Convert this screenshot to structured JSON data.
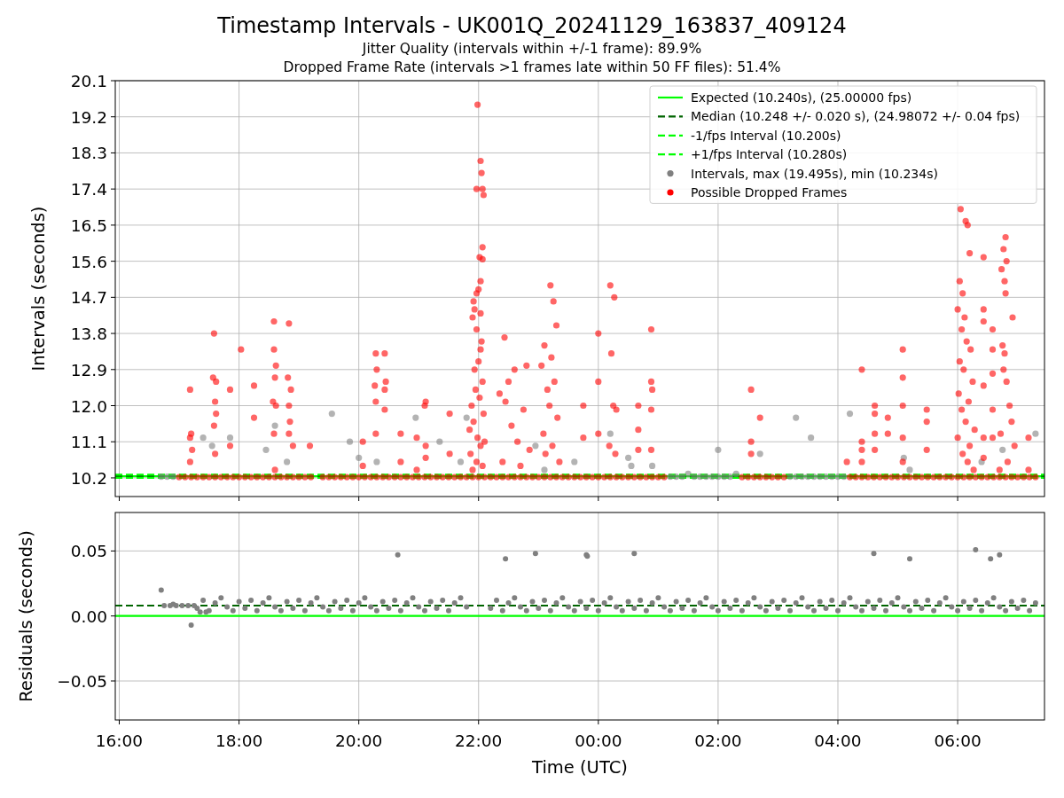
{
  "figure": {
    "title": "Timestamp Intervals - UK001Q_20241129_163837_409124",
    "subtitles": [
      "Jitter Quality (intervals within +/-1 frame): 89.9%",
      "Dropped Frame Rate (intervals >1 frames late within 50 FF files): 51.4%"
    ]
  },
  "plots": [
    {
      "chart_data": {
        "type": "scatter",
        "ylabel": "Intervals (seconds)",
        "legend": true,
        "grid": true,
        "xlim": [
          "2024-11-29T15:56",
          "2024-11-30T07:27"
        ],
        "ylim": [
          9.735,
          20.1
        ],
        "yticks": [
          {
            "value": 10.2,
            "label": "10.2"
          },
          {
            "value": 11.1,
            "label": "11.1"
          },
          {
            "value": 12.0,
            "label": "12.0"
          },
          {
            "value": 12.9,
            "label": "12.9"
          },
          {
            "value": 13.8,
            "label": "13.8"
          },
          {
            "value": 14.7,
            "label": "14.7"
          },
          {
            "value": 15.6,
            "label": "15.6"
          },
          {
            "value": 16.5,
            "label": "16.5"
          },
          {
            "value": 17.4,
            "label": "17.4"
          },
          {
            "value": 18.3,
            "label": "18.3"
          },
          {
            "value": 19.2,
            "label": "19.2"
          },
          {
            "value": 20.1,
            "label": "20.1"
          }
        ],
        "ref_lines": [
          {
            "axis": "y",
            "value": 10.24,
            "label": "Expected (10.240s), (25.00000 fps)",
            "color": "#00ff00"
          },
          {
            "axis": "y",
            "value": 10.248,
            "label": "Median (10.248 +/- 0.020 s), (24.98072 +/- 0.04 fps)",
            "color": "#006400"
          },
          {
            "axis": "y",
            "value": 10.2,
            "label": "-1/fps Interval (10.200s)",
            "color": "#00ff00"
          },
          {
            "axis": "y",
            "value": 10.28,
            "label": "+1/fps Interval (10.280s)",
            "color": "#00ff00"
          }
        ],
        "series": [
          {
            "name": "Intervals, max (19.495s), min (10.234s)",
            "color": "#808080",
            "x": [
              "2024-11-29T16:42",
              "2024-11-29T16:48",
              "2024-11-29T16:54",
              "2024-11-30T01:12",
              "2024-11-30T01:18",
              "2024-11-30T01:24",
              "2024-11-30T01:30",
              "2024-11-30T01:36",
              "2024-11-30T01:42",
              "2024-11-30T01:48",
              "2024-11-30T01:54",
              "2024-11-30T02:00",
              "2024-11-30T02:06",
              "2024-11-30T02:12",
              "2024-11-30T02:18",
              "2024-11-30T03:12",
              "2024-11-30T03:18",
              "2024-11-30T03:24",
              "2024-11-30T03:30",
              "2024-11-30T03:36",
              "2024-11-30T03:42",
              "2024-11-30T03:48",
              "2024-11-30T03:54",
              "2024-11-30T04:00",
              "2024-11-30T04:06",
              "2024-11-29T17:24",
              "2024-11-29T17:33",
              "2024-11-29T17:51",
              "2024-11-29T18:36",
              "2024-11-29T18:27",
              "2024-11-29T18:48",
              "2024-11-29T19:33",
              "2024-11-29T19:51",
              "2024-11-29T20:00",
              "2024-11-29T20:18",
              "2024-11-29T20:57",
              "2024-11-29T21:21",
              "2024-11-29T21:42",
              "2024-11-29T21:48",
              "2024-11-29T22:57",
              "2024-11-29T23:36",
              "2024-11-29T23:06",
              "2024-11-30T00:12",
              "2024-11-30T00:30",
              "2024-11-30T00:33",
              "2024-11-30T00:54",
              "2024-11-30T02:00",
              "2024-11-30T02:42",
              "2024-11-30T03:18",
              "2024-11-30T03:33",
              "2024-11-30T04:12",
              "2024-11-30T05:06",
              "2024-11-30T05:12",
              "2024-11-30T06:45",
              "2024-11-30T07:18",
              "2024-11-30T06:24"
            ],
            "values": [
              10.23,
              10.23,
              10.23,
              10.23,
              10.23,
              10.23,
              10.3,
              10.23,
              10.23,
              10.23,
              10.23,
              10.23,
              10.23,
              10.23,
              10.3,
              10.23,
              10.23,
              10.23,
              10.23,
              10.23,
              10.23,
              10.23,
              10.23,
              10.23,
              10.23,
              11.2,
              11.0,
              11.2,
              11.5,
              10.9,
              10.6,
              11.8,
              11.1,
              10.7,
              10.6,
              11.7,
              11.1,
              10.6,
              11.7,
              11.0,
              10.6,
              10.4,
              11.3,
              10.7,
              10.5,
              10.5,
              10.9,
              10.8,
              11.7,
              11.2,
              11.8,
              10.7,
              10.4,
              10.9,
              11.3,
              10.6
            ]
          },
          {
            "name": "Possible Dropped Frames",
            "color": "#ff0000",
            "x": [
              "2024-11-29T17:00",
              "2024-11-29T17:06",
              "2024-11-29T17:12",
              "2024-11-29T17:18",
              "2024-11-29T17:24",
              "2024-11-29T17:30",
              "2024-11-29T17:36",
              "2024-11-29T17:42",
              "2024-11-29T17:48",
              "2024-11-29T17:54",
              "2024-11-29T18:00",
              "2024-11-29T18:06",
              "2024-11-29T18:12",
              "2024-11-29T18:18",
              "2024-11-29T18:24",
              "2024-11-29T18:30",
              "2024-11-29T18:36",
              "2024-11-29T18:42",
              "2024-11-29T18:48",
              "2024-11-29T18:54",
              "2024-11-29T19:00",
              "2024-11-29T19:06",
              "2024-11-29T19:12",
              "2024-11-29T19:24",
              "2024-11-29T19:30",
              "2024-11-29T19:36",
              "2024-11-29T19:42",
              "2024-11-29T19:48",
              "2024-11-29T19:54",
              "2024-11-29T20:00",
              "2024-11-29T20:06",
              "2024-11-29T20:12",
              "2024-11-29T20:18",
              "2024-11-29T20:24",
              "2024-11-29T20:30",
              "2024-11-29T20:36",
              "2024-11-29T20:42",
              "2024-11-29T20:48",
              "2024-11-29T20:54",
              "2024-11-29T21:00",
              "2024-11-29T21:06",
              "2024-11-29T21:12",
              "2024-11-29T21:18",
              "2024-11-29T21:24",
              "2024-11-29T21:30",
              "2024-11-29T21:36",
              "2024-11-29T21:42",
              "2024-11-29T21:48",
              "2024-11-29T21:54",
              "2024-11-29T22:00",
              "2024-11-29T22:06",
              "2024-11-29T22:12",
              "2024-11-29T22:18",
              "2024-11-29T22:24",
              "2024-11-29T22:30",
              "2024-11-29T22:36",
              "2024-11-29T22:42",
              "2024-11-29T22:48",
              "2024-11-29T22:54",
              "2024-11-29T23:00",
              "2024-11-29T23:06",
              "2024-11-29T23:12",
              "2024-11-29T23:18",
              "2024-11-29T23:24",
              "2024-11-29T23:30",
              "2024-11-29T23:36",
              "2024-11-29T23:42",
              "2024-11-29T23:48",
              "2024-11-29T23:54",
              "2024-11-30T00:00",
              "2024-11-30T00:06",
              "2024-11-30T00:12",
              "2024-11-30T00:18",
              "2024-11-30T00:24",
              "2024-11-30T00:30",
              "2024-11-30T00:36",
              "2024-11-30T00:42",
              "2024-11-30T00:48",
              "2024-11-30T00:54",
              "2024-11-30T01:00",
              "2024-11-30T01:06",
              "2024-11-30T02:24",
              "2024-11-30T02:30",
              "2024-11-30T02:36",
              "2024-11-30T02:42",
              "2024-11-30T02:48",
              "2024-11-30T02:54",
              "2024-11-30T03:00",
              "2024-11-30T03:06",
              "2024-11-30T04:12",
              "2024-11-30T04:18",
              "2024-11-30T04:24",
              "2024-11-30T04:30",
              "2024-11-30T04:36",
              "2024-11-30T04:42",
              "2024-11-30T04:48",
              "2024-11-30T04:54",
              "2024-11-30T05:00",
              "2024-11-30T05:06",
              "2024-11-30T05:12",
              "2024-11-30T05:18",
              "2024-11-30T05:24",
              "2024-11-30T05:30",
              "2024-11-30T05:36",
              "2024-11-30T05:42",
              "2024-11-30T05:48",
              "2024-11-30T05:54",
              "2024-11-30T06:00",
              "2024-11-30T06:06",
              "2024-11-30T06:12",
              "2024-11-30T06:18",
              "2024-11-30T06:24",
              "2024-11-30T06:30",
              "2024-11-30T06:36",
              "2024-11-30T06:42",
              "2024-11-30T06:48",
              "2024-11-30T06:54",
              "2024-11-30T07:00",
              "2024-11-30T07:06",
              "2024-11-30T07:12",
              "2024-11-30T07:18",
              "2024-11-29T17:11",
              "2024-11-29T17:12",
              "2024-11-29T17:11",
              "2024-11-29T17:13",
              "2024-11-29T17:11",
              "2024-11-29T17:35",
              "2024-11-29T17:34",
              "2024-11-29T17:37",
              "2024-11-29T17:36",
              "2024-11-29T17:37",
              "2024-11-29T17:35",
              "2024-11-29T17:36",
              "2024-11-29T17:51",
              "2024-11-29T17:51",
              "2024-11-29T18:02",
              "2024-11-29T18:15",
              "2024-11-29T18:15",
              "2024-11-29T18:35",
              "2024-11-29T18:35",
              "2024-11-29T18:37",
              "2024-11-29T18:36",
              "2024-11-29T18:34",
              "2024-11-29T18:37",
              "2024-11-29T18:35",
              "2024-11-29T18:36",
              "2024-11-29T18:50",
              "2024-11-29T18:49",
              "2024-11-29T18:52",
              "2024-11-29T18:50",
              "2024-11-29T18:51",
              "2024-11-29T18:50",
              "2024-11-29T18:54",
              "2024-11-29T19:11",
              "2024-11-29T20:04",
              "2024-11-29T20:04",
              "2024-11-29T20:17",
              "2024-11-29T20:18",
              "2024-11-29T20:16",
              "2024-11-29T20:17",
              "2024-11-29T20:17",
              "2024-11-29T20:26",
              "2024-11-29T20:27",
              "2024-11-29T20:26",
              "2024-11-29T20:26",
              "2024-11-29T20:42",
              "2024-11-29T20:42",
              "2024-11-29T20:58",
              "2024-11-29T20:58",
              "2024-11-29T21:07",
              "2024-11-29T21:06",
              "2024-11-29T21:07",
              "2024-11-29T21:07",
              "2024-11-29T21:31",
              "2024-11-29T21:31",
              "2024-11-29T21:59",
              "2024-11-29T22:02",
              "2024-11-29T22:03",
              "2024-11-29T21:58",
              "2024-11-29T22:04",
              "2024-11-29T22:05",
              "2024-11-29T22:04",
              "2024-11-29T22:01",
              "2024-11-29T22:04",
              "2024-11-29T22:02",
              "2024-11-29T22:00",
              "2024-11-29T21:58",
              "2024-11-29T21:55",
              "2024-11-29T21:56",
              "2024-11-29T22:02",
              "2024-11-29T21:54",
              "2024-11-29T21:58",
              "2024-11-29T22:03",
              "2024-11-29T22:02",
              "2024-11-29T22:00",
              "2024-11-29T21:56",
              "2024-11-29T22:04",
              "2024-11-29T21:57",
              "2024-11-29T22:01",
              "2024-11-29T21:53",
              "2024-11-29T22:05",
              "2024-11-29T21:55",
              "2024-11-29T21:51",
              "2024-11-29T21:59",
              "2024-11-29T22:06",
              "2024-11-29T22:02",
              "2024-11-29T21:52",
              "2024-11-29T21:58",
              "2024-11-29T22:04",
              "2024-11-29T21:54",
              "2024-11-29T22:26",
              "2024-11-29T22:48",
              "2024-11-29T22:36",
              "2024-11-29T22:30",
              "2024-11-29T22:21",
              "2024-11-29T22:27",
              "2024-11-29T22:45",
              "2024-11-29T22:33",
              "2024-11-29T22:39",
              "2024-11-29T22:51",
              "2024-11-29T22:24",
              "2024-11-29T22:42",
              "2024-11-29T23:12",
              "2024-11-29T23:15",
              "2024-11-29T23:18",
              "2024-11-29T23:06",
              "2024-11-29T23:13",
              "2024-11-29T23:03",
              "2024-11-29T23:16",
              "2024-11-29T23:09",
              "2024-11-29T23:11",
              "2024-11-29T23:19",
              "2024-11-29T23:05",
              "2024-11-29T23:14",
              "2024-11-29T23:07",
              "2024-11-29T23:21",
              "2024-11-29T23:45",
              "2024-11-29T23:45",
              "2024-11-30T00:00",
              "2024-11-30T00:00",
              "2024-11-30T00:00",
              "2024-11-30T00:12",
              "2024-11-30T00:16",
              "2024-11-30T00:13",
              "2024-11-30T00:15",
              "2024-11-30T00:18",
              "2024-11-30T00:11",
              "2024-11-30T00:17",
              "2024-11-30T00:40",
              "2024-11-30T00:40",
              "2024-11-30T00:40",
              "2024-11-30T00:53",
              "2024-11-30T00:53",
              "2024-11-30T00:54",
              "2024-11-30T00:53",
              "2024-11-30T00:53",
              "2024-11-30T02:33",
              "2024-11-30T02:33",
              "2024-11-30T02:33",
              "2024-11-30T02:42",
              "2024-11-30T04:09",
              "2024-11-30T04:24",
              "2024-11-30T04:24",
              "2024-11-30T04:24",
              "2024-11-30T04:24",
              "2024-11-30T04:37",
              "2024-11-30T04:37",
              "2024-11-30T04:37",
              "2024-11-30T04:37",
              "2024-11-30T04:50",
              "2024-11-30T04:50",
              "2024-11-30T05:05",
              "2024-11-30T05:05",
              "2024-11-30T05:05",
              "2024-11-30T05:05",
              "2024-11-30T05:05",
              "2024-11-30T05:29",
              "2024-11-30T05:29",
              "2024-11-30T05:29",
              "2024-11-30T06:03",
              "2024-11-30T06:08",
              "2024-11-30T06:10",
              "2024-11-30T06:12",
              "2024-11-30T06:02",
              "2024-11-30T06:05",
              "2024-11-30T06:00",
              "2024-11-30T06:07",
              "2024-11-30T06:04",
              "2024-11-30T06:09",
              "2024-11-30T06:13",
              "2024-11-30T06:02",
              "2024-11-30T06:06",
              "2024-11-30T06:15",
              "2024-11-30T06:01",
              "2024-11-30T06:11",
              "2024-11-30T06:04",
              "2024-11-30T06:08",
              "2024-11-30T06:17",
              "2024-11-30T06:00",
              "2024-11-30T06:12",
              "2024-11-30T06:05",
              "2024-11-30T06:10",
              "2024-11-30T06:16",
              "2024-11-30T06:26",
              "2024-11-30T06:26",
              "2024-11-30T06:26",
              "2024-11-30T06:26",
              "2024-11-30T06:26",
              "2024-11-30T06:26",
              "2024-11-30T06:35",
              "2024-11-30T06:35",
              "2024-11-30T06:35",
              "2024-11-30T06:35",
              "2024-11-30T06:35",
              "2024-11-30T06:48",
              "2024-11-30T06:46",
              "2024-11-30T06:49",
              "2024-11-30T06:44",
              "2024-11-30T06:47",
              "2024-11-30T06:48",
              "2024-11-30T06:55",
              "2024-11-30T06:45",
              "2024-11-30T06:47",
              "2024-11-30T06:46",
              "2024-11-30T06:49",
              "2024-11-30T06:52",
              "2024-11-30T06:54",
              "2024-11-30T06:43",
              "2024-11-30T06:57",
              "2024-11-30T06:50",
              "2024-11-30T06:42",
              "2024-11-30T07:11",
              "2024-11-30T07:11"
            ],
            "values": [
              10.22,
              10.22,
              10.22,
              10.22,
              10.22,
              10.22,
              10.22,
              10.22,
              10.22,
              10.22,
              10.22,
              10.22,
              10.22,
              10.22,
              10.22,
              10.22,
              10.22,
              10.22,
              10.22,
              10.22,
              10.22,
              10.22,
              10.22,
              10.22,
              10.22,
              10.22,
              10.22,
              10.22,
              10.22,
              10.22,
              10.22,
              10.22,
              10.22,
              10.22,
              10.22,
              10.22,
              10.22,
              10.22,
              10.22,
              10.22,
              10.22,
              10.22,
              10.22,
              10.22,
              10.22,
              10.22,
              10.22,
              10.22,
              10.22,
              10.22,
              10.22,
              10.22,
              10.22,
              10.22,
              10.22,
              10.22,
              10.22,
              10.22,
              10.22,
              10.22,
              10.22,
              10.22,
              10.22,
              10.22,
              10.22,
              10.22,
              10.22,
              10.22,
              10.22,
              10.22,
              10.22,
              10.22,
              10.22,
              10.22,
              10.22,
              10.22,
              10.22,
              10.22,
              10.22,
              10.22,
              10.22,
              10.22,
              10.22,
              10.22,
              10.22,
              10.22,
              10.22,
              10.22,
              10.22,
              10.22,
              10.22,
              10.22,
              10.22,
              10.22,
              10.22,
              10.22,
              10.22,
              10.22,
              10.22,
              10.22,
              10.22,
              10.22,
              10.22,
              10.22,
              10.22,
              10.22,
              10.22,
              10.22,
              10.22,
              10.22,
              10.22,
              10.22,
              10.22,
              10.22,
              10.22,
              10.22,
              10.22,
              10.22,
              10.22,
              10.22,
              10.22,
              12.4,
              11.3,
              11.2,
              10.9,
              10.6,
              13.8,
              12.7,
              12.6,
              12.1,
              11.8,
              11.5,
              10.8,
              12.4,
              11.0,
              13.4,
              12.5,
              11.7,
              14.1,
              13.4,
              13.0,
              12.7,
              12.1,
              12.0,
              11.3,
              10.4,
              14.05,
              12.7,
              12.4,
              12.0,
              11.6,
              11.3,
              11.0,
              11.0,
              11.1,
              10.5,
              13.3,
              12.9,
              12.5,
              12.1,
              11.3,
              13.3,
              12.6,
              12.4,
              11.9,
              11.3,
              10.6,
              11.2,
              10.4,
              12.1,
              12.0,
              11.0,
              10.7,
              11.8,
              10.8,
              19.5,
              18.1,
              17.8,
              17.4,
              17.4,
              17.25,
              15.95,
              15.7,
              15.65,
              15.1,
              14.9,
              14.8,
              14.6,
              14.4,
              14.3,
              14.2,
              13.9,
              13.6,
              13.4,
              13.1,
              12.9,
              12.6,
              12.4,
              12.2,
              12.0,
              11.8,
              11.6,
              11.4,
              11.2,
              11.1,
              11.0,
              10.8,
              10.6,
              10.5,
              10.4,
              13.7,
              13.0,
              12.9,
              12.6,
              12.3,
              12.1,
              11.9,
              11.5,
              11.1,
              10.9,
              10.6,
              10.5,
              15.0,
              14.6,
              14.0,
              13.5,
              13.2,
              13.0,
              12.6,
              12.4,
              12.0,
              11.7,
              11.3,
              11.0,
              10.8,
              10.6,
              12.0,
              11.2,
              13.8,
              12.6,
              11.3,
              15.0,
              14.7,
              13.3,
              12.0,
              11.9,
              11.0,
              10.8,
              12.0,
              11.4,
              10.9,
              13.9,
              12.6,
              12.4,
              11.9,
              10.9,
              12.4,
              11.1,
              10.8,
              11.7,
              10.6,
              12.9,
              11.1,
              10.9,
              10.6,
              12.0,
              11.8,
              11.3,
              10.9,
              11.7,
              11.3,
              13.4,
              12.7,
              12.0,
              11.2,
              10.6,
              11.9,
              11.6,
              10.9,
              16.9,
              16.6,
              16.5,
              15.8,
              15.1,
              14.8,
              14.4,
              14.2,
              13.9,
              13.6,
              13.4,
              13.1,
              12.9,
              12.6,
              12.3,
              12.1,
              11.9,
              11.6,
              11.4,
              11.2,
              11.0,
              10.8,
              10.6,
              10.4,
              15.7,
              14.4,
              14.1,
              12.5,
              11.2,
              10.7,
              13.9,
              13.4,
              12.8,
              11.9,
              11.2,
              16.2,
              15.9,
              15.6,
              15.4,
              15.1,
              14.8,
              14.2,
              13.5,
              13.3,
              12.9,
              12.6,
              12.0,
              11.6,
              11.3,
              11.0,
              10.6,
              10.4,
              11.2,
              10.4
            ]
          }
        ]
      }
    },
    {
      "chart_data": {
        "type": "scatter",
        "xlabel": "Time (UTC)",
        "ylabel": "Residuals (seconds)",
        "grid": true,
        "xlim": [
          "2024-11-29T15:56",
          "2024-11-30T07:27"
        ],
        "ylim": [
          -0.08,
          0.0796
        ],
        "xticks": [
          {
            "value": "2024-11-29T16:00",
            "label": "16:00"
          },
          {
            "value": "2024-11-29T18:00",
            "label": "18:00"
          },
          {
            "value": "2024-11-29T20:00",
            "label": "20:00"
          },
          {
            "value": "2024-11-29T22:00",
            "label": "22:00"
          },
          {
            "value": "2024-11-30T00:00",
            "label": "00:00"
          },
          {
            "value": "2024-11-30T02:00",
            "label": "02:00"
          },
          {
            "value": "2024-11-30T04:00",
            "label": "04:00"
          },
          {
            "value": "2024-11-30T06:00",
            "label": "06:00"
          }
        ],
        "yticks": [
          {
            "value": 0.05,
            "label": "0.05"
          },
          {
            "value": 0.0,
            "label": "0.00"
          },
          {
            "value": -0.05,
            "label": "−0.05"
          }
        ],
        "ref_lines": [
          {
            "axis": "y",
            "value": 0.0,
            "color": "#00ff00"
          },
          {
            "axis": "y",
            "value": 0.008,
            "color": "#006400"
          }
        ],
        "series": [
          {
            "color": "#808080",
            "x": [
              "2024-11-29T16:42",
              "2024-11-29T16:54",
              "2024-11-29T17:12",
              "2024-11-29T17:21",
              "2024-11-29T17:27",
              "2024-11-29T20:39",
              "2024-11-29T22:27",
              "2024-11-29T22:57",
              "2024-11-29T23:48",
              "2024-11-29T23:49",
              "2024-11-30T00:36",
              "2024-11-30T04:36",
              "2024-11-30T05:12",
              "2024-11-30T06:18",
              "2024-11-30T06:33",
              "2024-11-30T06:42",
              "2024-11-29T16:45",
              "2024-11-29T16:51",
              "2024-11-29T16:57",
              "2024-11-29T17:03",
              "2024-11-29T17:09",
              "2024-11-29T17:15",
              "2024-11-29T17:18",
              "2024-11-29T17:24",
              "2024-11-29T17:30",
              "2024-11-29T17:36",
              "2024-11-29T17:42",
              "2024-11-29T17:48",
              "2024-11-29T17:54",
              "2024-11-29T18:00",
              "2024-11-29T18:06",
              "2024-11-29T18:12",
              "2024-11-29T18:18",
              "2024-11-29T18:24",
              "2024-11-29T18:30",
              "2024-11-29T18:36",
              "2024-11-29T18:42",
              "2024-11-29T18:48",
              "2024-11-29T18:54",
              "2024-11-29T19:00",
              "2024-11-29T19:06",
              "2024-11-29T19:12",
              "2024-11-29T19:18",
              "2024-11-29T19:24",
              "2024-11-29T19:30",
              "2024-11-29T19:36",
              "2024-11-29T19:42",
              "2024-11-29T19:48",
              "2024-11-29T19:54",
              "2024-11-29T20:00",
              "2024-11-29T20:06",
              "2024-11-29T20:12",
              "2024-11-29T20:18",
              "2024-11-29T20:24",
              "2024-11-29T20:30",
              "2024-11-29T20:36",
              "2024-11-29T20:42",
              "2024-11-29T20:48",
              "2024-11-29T20:54",
              "2024-11-29T21:00",
              "2024-11-29T21:06",
              "2024-11-29T21:12",
              "2024-11-29T21:18",
              "2024-11-29T21:24",
              "2024-11-29T21:30",
              "2024-11-29T21:36",
              "2024-11-29T21:42",
              "2024-11-29T21:48",
              "2024-11-29T22:12",
              "2024-11-29T22:18",
              "2024-11-29T22:24",
              "2024-11-29T22:30",
              "2024-11-29T22:36",
              "2024-11-29T22:42",
              "2024-11-29T22:48",
              "2024-11-29T22:54",
              "2024-11-29T23:00",
              "2024-11-29T23:06",
              "2024-11-29T23:12",
              "2024-11-29T23:18",
              "2024-11-29T23:24",
              "2024-11-29T23:30",
              "2024-11-29T23:36",
              "2024-11-29T23:42",
              "2024-11-29T23:48",
              "2024-11-29T23:54",
              "2024-11-30T00:00",
              "2024-11-30T00:06",
              "2024-11-30T00:12",
              "2024-11-30T00:18",
              "2024-11-30T00:24",
              "2024-11-30T00:30",
              "2024-11-30T00:36",
              "2024-11-30T00:42",
              "2024-11-30T00:48",
              "2024-11-30T00:54",
              "2024-11-30T01:00",
              "2024-11-30T01:06",
              "2024-11-30T01:12",
              "2024-11-30T01:18",
              "2024-11-30T01:24",
              "2024-11-30T01:30",
              "2024-11-30T01:36",
              "2024-11-30T01:42",
              "2024-11-30T01:48",
              "2024-11-30T01:54",
              "2024-11-30T02:00",
              "2024-11-30T02:06",
              "2024-11-30T02:12",
              "2024-11-30T02:18",
              "2024-11-30T02:24",
              "2024-11-30T02:30",
              "2024-11-30T02:36",
              "2024-11-30T02:42",
              "2024-11-30T02:48",
              "2024-11-30T02:54",
              "2024-11-30T03:00",
              "2024-11-30T03:06",
              "2024-11-30T03:12",
              "2024-11-30T03:18",
              "2024-11-30T03:24",
              "2024-11-30T03:30",
              "2024-11-30T03:36",
              "2024-11-30T03:42",
              "2024-11-30T03:48",
              "2024-11-30T03:54",
              "2024-11-30T04:00",
              "2024-11-30T04:06",
              "2024-11-30T04:12",
              "2024-11-30T04:18",
              "2024-11-30T04:24",
              "2024-11-30T04:30",
              "2024-11-30T04:36",
              "2024-11-30T04:42",
              "2024-11-30T04:48",
              "2024-11-30T04:54",
              "2024-11-30T05:00",
              "2024-11-30T05:06",
              "2024-11-30T05:12",
              "2024-11-30T05:18",
              "2024-11-30T05:24",
              "2024-11-30T05:30",
              "2024-11-30T05:36",
              "2024-11-30T05:42",
              "2024-11-30T05:48",
              "2024-11-30T05:54",
              "2024-11-30T06:00",
              "2024-11-30T06:06",
              "2024-11-30T06:12",
              "2024-11-30T06:18",
              "2024-11-30T06:24",
              "2024-11-30T06:30",
              "2024-11-30T06:36",
              "2024-11-30T06:42",
              "2024-11-30T06:48",
              "2024-11-30T06:54",
              "2024-11-30T07:00",
              "2024-11-30T07:06",
              "2024-11-30T07:12",
              "2024-11-30T07:18"
            ],
            "values": [
              0.02,
              0.009,
              -0.007,
              0.003,
              0.003,
              0.047,
              0.044,
              0.048,
              0.047,
              0.046,
              0.048,
              0.048,
              0.044,
              0.051,
              0.044,
              0.047,
              0.008,
              0.008,
              0.008,
              0.008,
              0.008,
              0.008,
              0.006,
              0.012,
              0.004,
              0.01,
              0.014,
              0.007,
              0.004,
              0.011,
              0.006,
              0.012,
              0.004,
              0.01,
              0.014,
              0.007,
              0.004,
              0.011,
              0.006,
              0.012,
              0.004,
              0.01,
              0.014,
              0.007,
              0.004,
              0.011,
              0.006,
              0.012,
              0.004,
              0.01,
              0.014,
              0.007,
              0.004,
              0.011,
              0.006,
              0.012,
              0.004,
              0.01,
              0.014,
              0.007,
              0.004,
              0.011,
              0.006,
              0.012,
              0.004,
              0.01,
              0.014,
              0.007,
              0.006,
              0.012,
              0.004,
              0.01,
              0.014,
              0.007,
              0.004,
              0.011,
              0.006,
              0.012,
              0.004,
              0.01,
              0.014,
              0.007,
              0.004,
              0.011,
              0.006,
              0.012,
              0.004,
              0.01,
              0.014,
              0.007,
              0.004,
              0.011,
              0.006,
              0.012,
              0.004,
              0.01,
              0.014,
              0.007,
              0.004,
              0.011,
              0.006,
              0.012,
              0.004,
              0.01,
              0.014,
              0.007,
              0.004,
              0.011,
              0.006,
              0.012,
              0.004,
              0.01,
              0.014,
              0.007,
              0.004,
              0.011,
              0.006,
              0.012,
              0.004,
              0.01,
              0.014,
              0.007,
              0.004,
              0.011,
              0.006,
              0.012,
              0.004,
              0.01,
              0.014,
              0.007,
              0.004,
              0.011,
              0.006,
              0.012,
              0.004,
              0.01,
              0.014,
              0.007,
              0.004,
              0.011,
              0.006,
              0.012,
              0.004,
              0.01,
              0.014,
              0.007,
              0.004,
              0.011,
              0.006,
              0.012,
              0.004,
              0.01,
              0.014,
              0.007,
              0.004,
              0.011,
              0.006,
              0.012,
              0.004,
              0.01
            ]
          }
        ]
      }
    }
  ]
}
